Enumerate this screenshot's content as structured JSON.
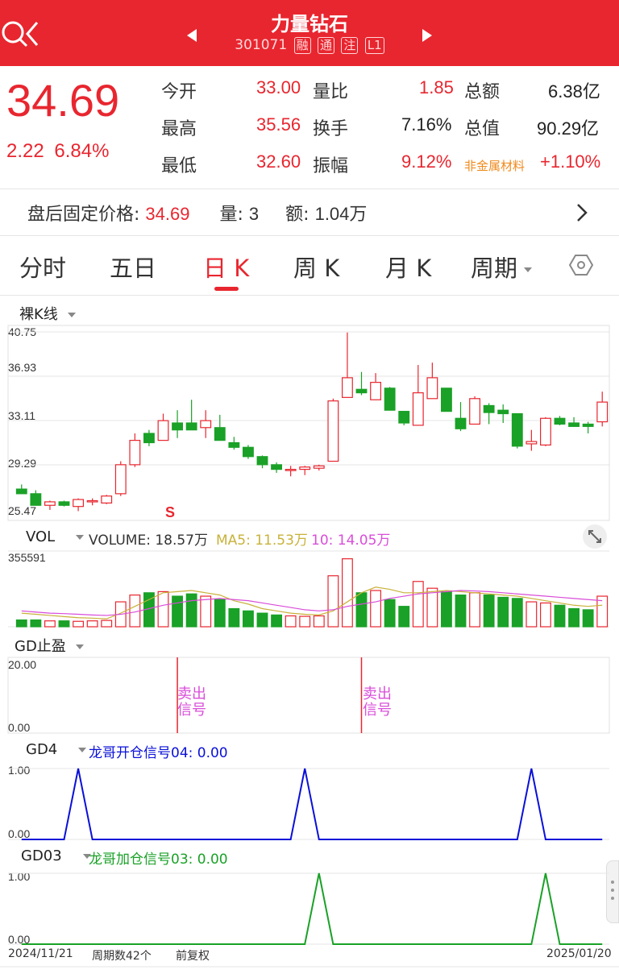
{
  "header": {
    "title": "力量钻石",
    "code": "301071",
    "tags": [
      "融",
      "通",
      "注",
      "L1"
    ]
  },
  "quote": {
    "price": "34.69",
    "change": "2.22",
    "change_pct": "6.84%",
    "rows": [
      {
        "l1": "今开",
        "v1": "33.00",
        "l2": "量比",
        "v2": "1.85",
        "l3": "总额",
        "v3": "6.38亿"
      },
      {
        "l1": "最高",
        "v1": "35.56",
        "l2": "换手",
        "v2": "7.16%",
        "l3": "总值",
        "v3": "90.29亿"
      },
      {
        "l1": "最低",
        "v1": "32.60",
        "l2": "振幅",
        "v2": "9.12%",
        "l3": "非金属材料",
        "v3": "+1.10%"
      }
    ]
  },
  "after_hours": {
    "label": "盘后固定价格:",
    "price": "34.69",
    "vol_label": "量:",
    "vol": "3",
    "amt_label": "额:",
    "amt": "1.04万"
  },
  "tabs": [
    "分时",
    "五日",
    "日 K",
    "周 K",
    "月 K",
    "周期"
  ],
  "kline": {
    "indicator": "裸K线",
    "y_ticks": [
      "40.75",
      "36.93",
      "33.11",
      "29.29",
      "25.47"
    ],
    "marker": "S"
  },
  "volume": {
    "label": "VOL",
    "volume_text": "VOLUME: 18.57万",
    "ma5_text": "MA5: 11.53万",
    "ma10_text": "10: 14.05万",
    "max": "355591"
  },
  "gd_stop": {
    "label": "GD止盈",
    "y_top": "20.00",
    "y_bottom": "0.00",
    "signals": [
      "卖出\n信号",
      "卖出\n信号"
    ]
  },
  "gd4": {
    "label": "GD4",
    "legend": "龙哥开仓信号04: 0.00",
    "y_top": "1.00",
    "y_bottom": "0.00"
  },
  "gd03": {
    "label": "GD03",
    "legend": "龙哥加仓信号03: 0.00",
    "y_top": "1.00",
    "y_bottom": "0.00"
  },
  "footer": {
    "start": "2024/11/21",
    "period_count": "周期数42个",
    "adjust": "前复权",
    "end": "2025/01/20"
  },
  "colors": {
    "up": "#e8262f",
    "down": "#1aa127",
    "ma5": "#c8b23a",
    "ma10": "#d94dd9",
    "gd4": "#0a10d8",
    "gd03": "#1aa127"
  },
  "candles": [
    {
      "o": 27.2,
      "h": 27.6,
      "l": 26.8,
      "c": 26.8
    },
    {
      "o": 26.8,
      "h": 27.1,
      "l": 25.8,
      "c": 25.8
    },
    {
      "o": 25.8,
      "h": 26.2,
      "l": 25.4,
      "c": 26.1
    },
    {
      "o": 26.1,
      "h": 26.2,
      "l": 25.7,
      "c": 25.8
    },
    {
      "o": 25.7,
      "h": 26.4,
      "l": 25.3,
      "c": 26.3
    },
    {
      "o": 26.1,
      "h": 26.4,
      "l": 25.8,
      "c": 26.2
    },
    {
      "o": 26.0,
      "h": 26.7,
      "l": 25.9,
      "c": 26.6
    },
    {
      "o": 26.8,
      "h": 29.6,
      "l": 26.6,
      "c": 29.3
    },
    {
      "o": 29.3,
      "h": 32.0,
      "l": 29.1,
      "c": 31.4
    },
    {
      "o": 32.0,
      "h": 32.3,
      "l": 30.9,
      "c": 31.2
    },
    {
      "o": 31.4,
      "h": 33.7,
      "l": 31.4,
      "c": 33.1
    },
    {
      "o": 32.9,
      "h": 34.0,
      "l": 31.6,
      "c": 32.3
    },
    {
      "o": 32.9,
      "h": 34.9,
      "l": 32.5,
      "c": 32.3
    },
    {
      "o": 32.5,
      "h": 34.0,
      "l": 31.6,
      "c": 33.1
    },
    {
      "o": 32.5,
      "h": 33.6,
      "l": 31.7,
      "c": 31.4
    },
    {
      "o": 31.2,
      "h": 31.7,
      "l": 30.6,
      "c": 30.8
    },
    {
      "o": 30.8,
      "h": 31.0,
      "l": 29.8,
      "c": 30.0
    },
    {
      "o": 30.0,
      "h": 30.1,
      "l": 29.0,
      "c": 29.3
    },
    {
      "o": 29.3,
      "h": 29.5,
      "l": 28.6,
      "c": 28.9
    },
    {
      "o": 28.8,
      "h": 29.2,
      "l": 28.3,
      "c": 28.9
    },
    {
      "o": 28.9,
      "h": 29.2,
      "l": 28.4,
      "c": 29.1
    },
    {
      "o": 29.0,
      "h": 29.3,
      "l": 28.8,
      "c": 29.2
    },
    {
      "o": 29.6,
      "h": 35.0,
      "l": 29.6,
      "c": 34.8
    },
    {
      "o": 35.1,
      "h": 40.7,
      "l": 35.1,
      "c": 36.8
    },
    {
      "o": 35.8,
      "h": 37.3,
      "l": 35.3,
      "c": 35.5
    },
    {
      "o": 34.9,
      "h": 37.2,
      "l": 34.9,
      "c": 36.4
    },
    {
      "o": 35.9,
      "h": 36.0,
      "l": 34.0,
      "c": 34.0
    },
    {
      "o": 33.9,
      "h": 33.9,
      "l": 32.7,
      "c": 32.9
    },
    {
      "o": 32.7,
      "h": 37.9,
      "l": 32.7,
      "c": 35.5
    },
    {
      "o": 35.0,
      "h": 38.1,
      "l": 35.0,
      "c": 36.8
    },
    {
      "o": 35.9,
      "h": 35.9,
      "l": 33.9,
      "c": 33.9
    },
    {
      "o": 33.3,
      "h": 34.7,
      "l": 32.2,
      "c": 32.4
    },
    {
      "o": 32.8,
      "h": 35.2,
      "l": 32.8,
      "c": 35.0
    },
    {
      "o": 34.4,
      "h": 34.6,
      "l": 32.8,
      "c": 33.8
    },
    {
      "o": 34.0,
      "h": 34.5,
      "l": 32.9,
      "c": 33.7
    },
    {
      "o": 33.7,
      "h": 33.7,
      "l": 30.7,
      "c": 30.9
    },
    {
      "o": 31.1,
      "h": 32.3,
      "l": 30.5,
      "c": 31.3
    },
    {
      "o": 31.0,
      "h": 33.4,
      "l": 30.9,
      "c": 33.3
    },
    {
      "o": 33.3,
      "h": 33.5,
      "l": 32.7,
      "c": 32.8
    },
    {
      "o": 32.9,
      "h": 33.4,
      "l": 32.6,
      "c": 32.6
    },
    {
      "o": 32.8,
      "h": 33.0,
      "l": 32.0,
      "c": 32.6
    },
    {
      "o": 33.0,
      "h": 35.6,
      "l": 32.6,
      "c": 34.7
    }
  ],
  "volumes": [
    30,
    30,
    26,
    26,
    24,
    26,
    28,
    110,
    140,
    150,
    155,
    135,
    145,
    135,
    120,
    80,
    70,
    60,
    52,
    48,
    46,
    48,
    225,
    300,
    150,
    160,
    120,
    90,
    200,
    170,
    155,
    140,
    150,
    140,
    130,
    125,
    110,
    105,
    95,
    80,
    75,
    135
  ],
  "ma5_line": [
    60,
    55,
    50,
    45,
    40,
    38,
    35,
    60,
    90,
    120,
    150,
    155,
    160,
    150,
    140,
    115,
    100,
    80,
    70,
    60,
    55,
    52,
    70,
    110,
    150,
    175,
    165,
    150,
    150,
    155,
    160,
    155,
    150,
    145,
    140,
    135,
    125,
    115,
    105,
    95,
    90,
    95
  ],
  "ma10_line": [
    70,
    65,
    60,
    58,
    55,
    52,
    50,
    55,
    65,
    80,
    95,
    105,
    115,
    120,
    125,
    120,
    115,
    105,
    95,
    85,
    75,
    70,
    75,
    90,
    100,
    110,
    125,
    135,
    145,
    150,
    155,
    160,
    158,
    155,
    150,
    145,
    140,
    135,
    130,
    125,
    120,
    115
  ],
  "gd_stop_signals": [
    11,
    24
  ],
  "gd4_signals": [
    4,
    20,
    36
  ],
  "gd03_signals": [
    21,
    37
  ]
}
